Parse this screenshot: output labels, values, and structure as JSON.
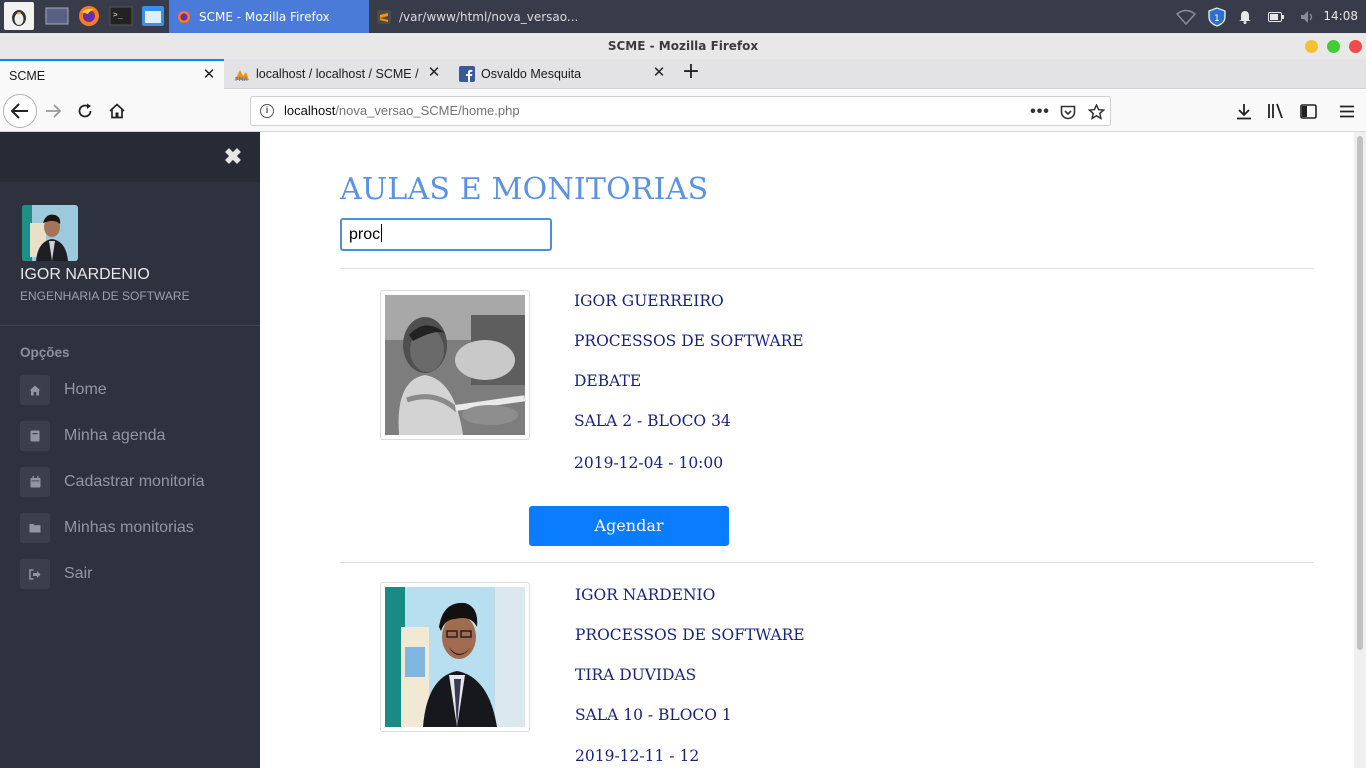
{
  "os": {
    "taskbar": {
      "windows": [
        {
          "title": "SCME - Mozilla Firefox",
          "active": true
        },
        {
          "title": "/var/www/html/nova_versao...",
          "active": false
        }
      ],
      "clock": "14:08"
    }
  },
  "browser": {
    "window_title": "SCME - Mozilla Firefox",
    "tabs": [
      {
        "label": "SCME"
      },
      {
        "label": "localhost / localhost / SCME / "
      },
      {
        "label": "Osvaldo Mesquita"
      }
    ],
    "url": {
      "host": "localhost",
      "path": "/nova_versao_SCME/home.php"
    }
  },
  "sidebar": {
    "user_name": "IGOR NARDENIO",
    "user_course": "ENGENHARIA DE SOFTWARE",
    "section_title": "Opções",
    "items": [
      {
        "label": "Home",
        "icon": "home-icon"
      },
      {
        "label": "Minha agenda",
        "icon": "book-icon"
      },
      {
        "label": "Cadastrar monitoria",
        "icon": "calendar-icon"
      },
      {
        "label": "Minhas monitorias",
        "icon": "folder-icon"
      },
      {
        "label": "Sair",
        "icon": "sign-out-icon"
      }
    ]
  },
  "main": {
    "title": "AULAS E MONITORIAS",
    "search_value": "proc",
    "cards": [
      {
        "monitor": "IGOR GUERREIRO",
        "subject": "PROCESSOS DE SOFTWARE",
        "type": "DEBATE",
        "location": "SALA 2 - BLOCO 34",
        "datetime": "2019-12-04 - 10:00",
        "button_label": "Agendar"
      },
      {
        "monitor": "IGOR NARDENIO",
        "subject": "PROCESSOS DE SOFTWARE",
        "type": "TIRA DUVIDAS",
        "location": "SALA 10 - BLOCO 1",
        "datetime": "2019-12-11 - 12"
      }
    ]
  },
  "colors": {
    "sidebar_bg": "#2d323e",
    "title_blue": "#5b92e5",
    "info_text": "#1a237e",
    "button_blue": "#0a7cff",
    "taskbar_bg": "#383c4a",
    "active_window": "#4a7bd8"
  }
}
